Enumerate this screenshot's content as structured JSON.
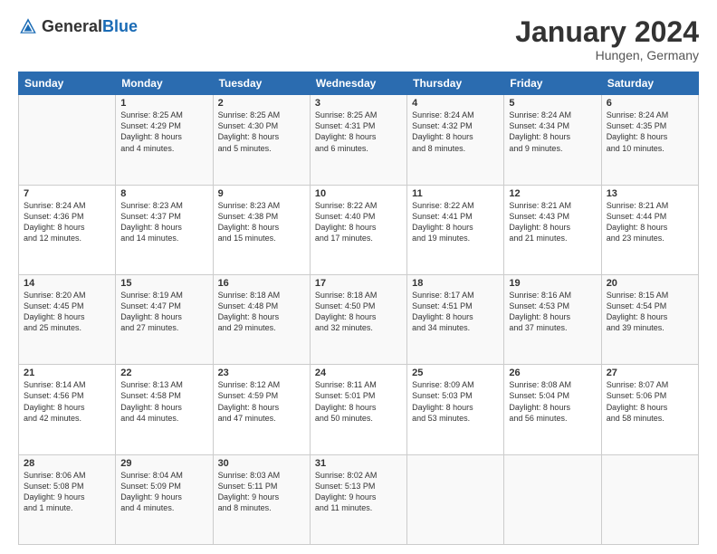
{
  "header": {
    "logo": {
      "general": "General",
      "blue": "Blue"
    },
    "title": "January 2024",
    "location": "Hungen, Germany"
  },
  "calendar": {
    "days_of_week": [
      "Sunday",
      "Monday",
      "Tuesday",
      "Wednesday",
      "Thursday",
      "Friday",
      "Saturday"
    ],
    "weeks": [
      {
        "days": [
          {
            "num": "",
            "info": ""
          },
          {
            "num": "1",
            "info": "Sunrise: 8:25 AM\nSunset: 4:29 PM\nDaylight: 8 hours\nand 4 minutes."
          },
          {
            "num": "2",
            "info": "Sunrise: 8:25 AM\nSunset: 4:30 PM\nDaylight: 8 hours\nand 5 minutes."
          },
          {
            "num": "3",
            "info": "Sunrise: 8:25 AM\nSunset: 4:31 PM\nDaylight: 8 hours\nand 6 minutes."
          },
          {
            "num": "4",
            "info": "Sunrise: 8:24 AM\nSunset: 4:32 PM\nDaylight: 8 hours\nand 8 minutes."
          },
          {
            "num": "5",
            "info": "Sunrise: 8:24 AM\nSunset: 4:34 PM\nDaylight: 8 hours\nand 9 minutes."
          },
          {
            "num": "6",
            "info": "Sunrise: 8:24 AM\nSunset: 4:35 PM\nDaylight: 8 hours\nand 10 minutes."
          }
        ]
      },
      {
        "days": [
          {
            "num": "7",
            "info": "Sunrise: 8:24 AM\nSunset: 4:36 PM\nDaylight: 8 hours\nand 12 minutes."
          },
          {
            "num": "8",
            "info": "Sunrise: 8:23 AM\nSunset: 4:37 PM\nDaylight: 8 hours\nand 14 minutes."
          },
          {
            "num": "9",
            "info": "Sunrise: 8:23 AM\nSunset: 4:38 PM\nDaylight: 8 hours\nand 15 minutes."
          },
          {
            "num": "10",
            "info": "Sunrise: 8:22 AM\nSunset: 4:40 PM\nDaylight: 8 hours\nand 17 minutes."
          },
          {
            "num": "11",
            "info": "Sunrise: 8:22 AM\nSunset: 4:41 PM\nDaylight: 8 hours\nand 19 minutes."
          },
          {
            "num": "12",
            "info": "Sunrise: 8:21 AM\nSunset: 4:43 PM\nDaylight: 8 hours\nand 21 minutes."
          },
          {
            "num": "13",
            "info": "Sunrise: 8:21 AM\nSunset: 4:44 PM\nDaylight: 8 hours\nand 23 minutes."
          }
        ]
      },
      {
        "days": [
          {
            "num": "14",
            "info": "Sunrise: 8:20 AM\nSunset: 4:45 PM\nDaylight: 8 hours\nand 25 minutes."
          },
          {
            "num": "15",
            "info": "Sunrise: 8:19 AM\nSunset: 4:47 PM\nDaylight: 8 hours\nand 27 minutes."
          },
          {
            "num": "16",
            "info": "Sunrise: 8:18 AM\nSunset: 4:48 PM\nDaylight: 8 hours\nand 29 minutes."
          },
          {
            "num": "17",
            "info": "Sunrise: 8:18 AM\nSunset: 4:50 PM\nDaylight: 8 hours\nand 32 minutes."
          },
          {
            "num": "18",
            "info": "Sunrise: 8:17 AM\nSunset: 4:51 PM\nDaylight: 8 hours\nand 34 minutes."
          },
          {
            "num": "19",
            "info": "Sunrise: 8:16 AM\nSunset: 4:53 PM\nDaylight: 8 hours\nand 37 minutes."
          },
          {
            "num": "20",
            "info": "Sunrise: 8:15 AM\nSunset: 4:54 PM\nDaylight: 8 hours\nand 39 minutes."
          }
        ]
      },
      {
        "days": [
          {
            "num": "21",
            "info": "Sunrise: 8:14 AM\nSunset: 4:56 PM\nDaylight: 8 hours\nand 42 minutes."
          },
          {
            "num": "22",
            "info": "Sunrise: 8:13 AM\nSunset: 4:58 PM\nDaylight: 8 hours\nand 44 minutes."
          },
          {
            "num": "23",
            "info": "Sunrise: 8:12 AM\nSunset: 4:59 PM\nDaylight: 8 hours\nand 47 minutes."
          },
          {
            "num": "24",
            "info": "Sunrise: 8:11 AM\nSunset: 5:01 PM\nDaylight: 8 hours\nand 50 minutes."
          },
          {
            "num": "25",
            "info": "Sunrise: 8:09 AM\nSunset: 5:03 PM\nDaylight: 8 hours\nand 53 minutes."
          },
          {
            "num": "26",
            "info": "Sunrise: 8:08 AM\nSunset: 5:04 PM\nDaylight: 8 hours\nand 56 minutes."
          },
          {
            "num": "27",
            "info": "Sunrise: 8:07 AM\nSunset: 5:06 PM\nDaylight: 8 hours\nand 58 minutes."
          }
        ]
      },
      {
        "days": [
          {
            "num": "28",
            "info": "Sunrise: 8:06 AM\nSunset: 5:08 PM\nDaylight: 9 hours\nand 1 minute."
          },
          {
            "num": "29",
            "info": "Sunrise: 8:04 AM\nSunset: 5:09 PM\nDaylight: 9 hours\nand 4 minutes."
          },
          {
            "num": "30",
            "info": "Sunrise: 8:03 AM\nSunset: 5:11 PM\nDaylight: 9 hours\nand 8 minutes."
          },
          {
            "num": "31",
            "info": "Sunrise: 8:02 AM\nSunset: 5:13 PM\nDaylight: 9 hours\nand 11 minutes."
          },
          {
            "num": "",
            "info": ""
          },
          {
            "num": "",
            "info": ""
          },
          {
            "num": "",
            "info": ""
          }
        ]
      }
    ]
  }
}
